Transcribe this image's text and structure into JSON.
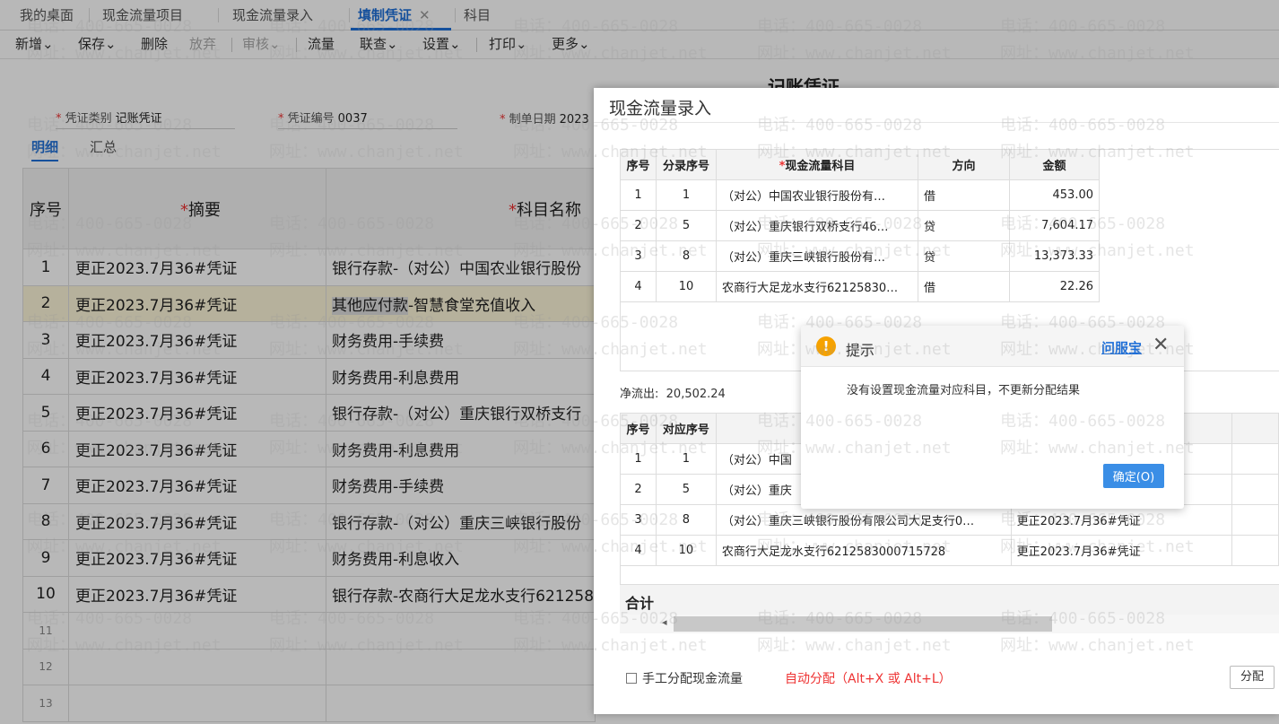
{
  "tabs": [
    {
      "label": "我的桌面"
    },
    {
      "label": "现金流量项目"
    },
    {
      "label": "现金流量录入"
    },
    {
      "label": "填制凭证",
      "close": "✕"
    },
    {
      "label": "科目"
    }
  ],
  "toolbar": {
    "new": "新增",
    "save": "保存",
    "delete": "删除",
    "discard": "放弃",
    "review": "审核",
    "flow": "流量",
    "linkquery": "联查",
    "settings": "设置",
    "print": "打印",
    "more": "更多",
    "caret": "⌄"
  },
  "voucher": {
    "title": "记账凭证",
    "type_label": "凭证类别",
    "type_value": "记账凭证",
    "number_label": "凭证编号",
    "number_value": "0037",
    "date_label": "制单日期",
    "date_value": "2023",
    "req": "*"
  },
  "subtabs": {
    "detail": "明细",
    "summary": "汇总"
  },
  "grid": {
    "headers": {
      "seq": "序号",
      "summary": "摘要",
      "account": "科目名称"
    },
    "rows": [
      {
        "seq": "1",
        "summary": "更正2023.7月36#凭证",
        "account": "银行存款-（对公）中国农业银行股份"
      },
      {
        "seq": "2",
        "summary": "更正2023.7月36#凭证",
        "account_hl": "其他应付款",
        "account": "-智慧食堂充值收入"
      },
      {
        "seq": "3",
        "summary": "更正2023.7月36#凭证",
        "account": "财务费用-手续费"
      },
      {
        "seq": "4",
        "summary": "更正2023.7月36#凭证",
        "account": "财务费用-利息费用"
      },
      {
        "seq": "5",
        "summary": "更正2023.7月36#凭证",
        "account": "银行存款-（对公）重庆银行双桥支行"
      },
      {
        "seq": "6",
        "summary": "更正2023.7月36#凭证",
        "account": "财务费用-利息费用"
      },
      {
        "seq": "7",
        "summary": "更正2023.7月36#凭证",
        "account": "财务费用-手续费"
      },
      {
        "seq": "8",
        "summary": "更正2023.7月36#凭证",
        "account": "银行存款-（对公）重庆三峡银行股份"
      },
      {
        "seq": "9",
        "summary": "更正2023.7月36#凭证",
        "account": "财务费用-利息收入"
      },
      {
        "seq": "10",
        "summary": "更正2023.7月36#凭证",
        "account": "银行存款-农商行大足龙水支行621258"
      },
      {
        "seq": "11",
        "summary": "",
        "account": ""
      },
      {
        "seq": "12",
        "summary": "",
        "account": ""
      },
      {
        "seq": "13",
        "summary": "",
        "account": ""
      }
    ]
  },
  "modal": {
    "title": "现金流量录入",
    "t1_headers": {
      "seq": "序号",
      "entry_seq": "分录序号",
      "req": "*",
      "item": "现金流量科目",
      "direction": "方向",
      "amount": "金额"
    },
    "t1_rows": [
      {
        "seq": "1",
        "entry": "1",
        "item": "（对公）中国农业银行股份有…",
        "direction": "借",
        "amount": "453.00"
      },
      {
        "seq": "2",
        "entry": "5",
        "item": "（对公）重庆银行双桥支行46…",
        "direction": "贷",
        "amount": "7,604.17"
      },
      {
        "seq": "3",
        "entry": "8",
        "item": "（对公）重庆三峡银行股份有…",
        "direction": "贷",
        "amount": "13,373.33"
      },
      {
        "seq": "4",
        "entry": "10",
        "item": "农商行大足龙水支行62125830…",
        "direction": "借",
        "amount": "22.26"
      }
    ],
    "net_label": "净流出:",
    "net_value": "20,502.24",
    "t2_headers": {
      "seq": "序号",
      "corr_seq": "对应序号"
    },
    "t2_rows": [
      {
        "seq": "1",
        "corr": "1",
        "item": "（对公）中国",
        "summary": ""
      },
      {
        "seq": "2",
        "corr": "5",
        "item": "（对公）重庆",
        "summary": ""
      },
      {
        "seq": "3",
        "corr": "8",
        "item": "（对公）重庆三峡银行股份有限公司大足支行0…",
        "summary": "更正2023.7月36#凭证"
      },
      {
        "seq": "4",
        "corr": "10",
        "item": "农商行大足龙水支行6212583000715728",
        "summary": "更正2023.7月36#凭证"
      }
    ],
    "total_label": "合计",
    "scroll_arrow": "◂",
    "manual_label": "手工分配现金流量",
    "auto_label": "自动分配（Alt+X 或 Alt+L）",
    "distribute_button": "分配"
  },
  "alert": {
    "icon": "!",
    "title": "提示",
    "link": "问服宝",
    "close": "✕",
    "message": "没有设置现金流量对应科目，不更新分配结果",
    "ok_button": "确定(O)"
  },
  "watermark": {
    "phone": "电话：400-665-0028",
    "site": "网址：www.chanjet.net"
  }
}
